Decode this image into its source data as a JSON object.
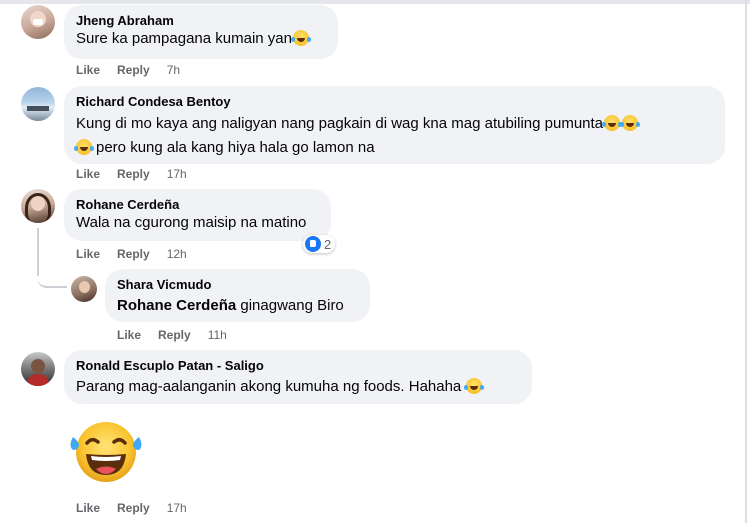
{
  "comments": [
    {
      "name": "Jheng Abraham",
      "text": "Sure ka pampagana kumain yan",
      "like": "Like",
      "reply": "Reply",
      "time": "7h"
    },
    {
      "name": "Richard Condesa Bentoy",
      "text_line1": "Kung di mo kaya ang naligyan nang pagkain di wag kna mag atubiling pumunta",
      "text_line2": "pero kung ala kang hiya hala go lamon na",
      "like": "Like",
      "reply": "Reply",
      "time": "17h"
    },
    {
      "name": "Rohane Cerdeña",
      "text": "Wala na cgurong maisip na matino",
      "like": "Like",
      "reply": "Reply",
      "time": "12h",
      "reaction_count": "2"
    },
    {
      "name": "Shara Vicmudo",
      "mention": "Rohane Cerdeña",
      "text": "ginagwang Biro",
      "like": "Like",
      "reply": "Reply",
      "time": "11h"
    },
    {
      "name": "Ronald Escuplo Patan - Saligo",
      "text": "Parang mag-aalanganin akong kumuha ng foods. Hahaha",
      "like": "Like",
      "reply": "Reply",
      "time": "17h"
    }
  ],
  "colors": {
    "bubble": "#f0f2f5",
    "meta": "#65676b",
    "like_blue": "#1877f2"
  },
  "icons": {
    "laugh": "face-with-tears-of-joy-icon",
    "like": "like-reaction-icon"
  }
}
